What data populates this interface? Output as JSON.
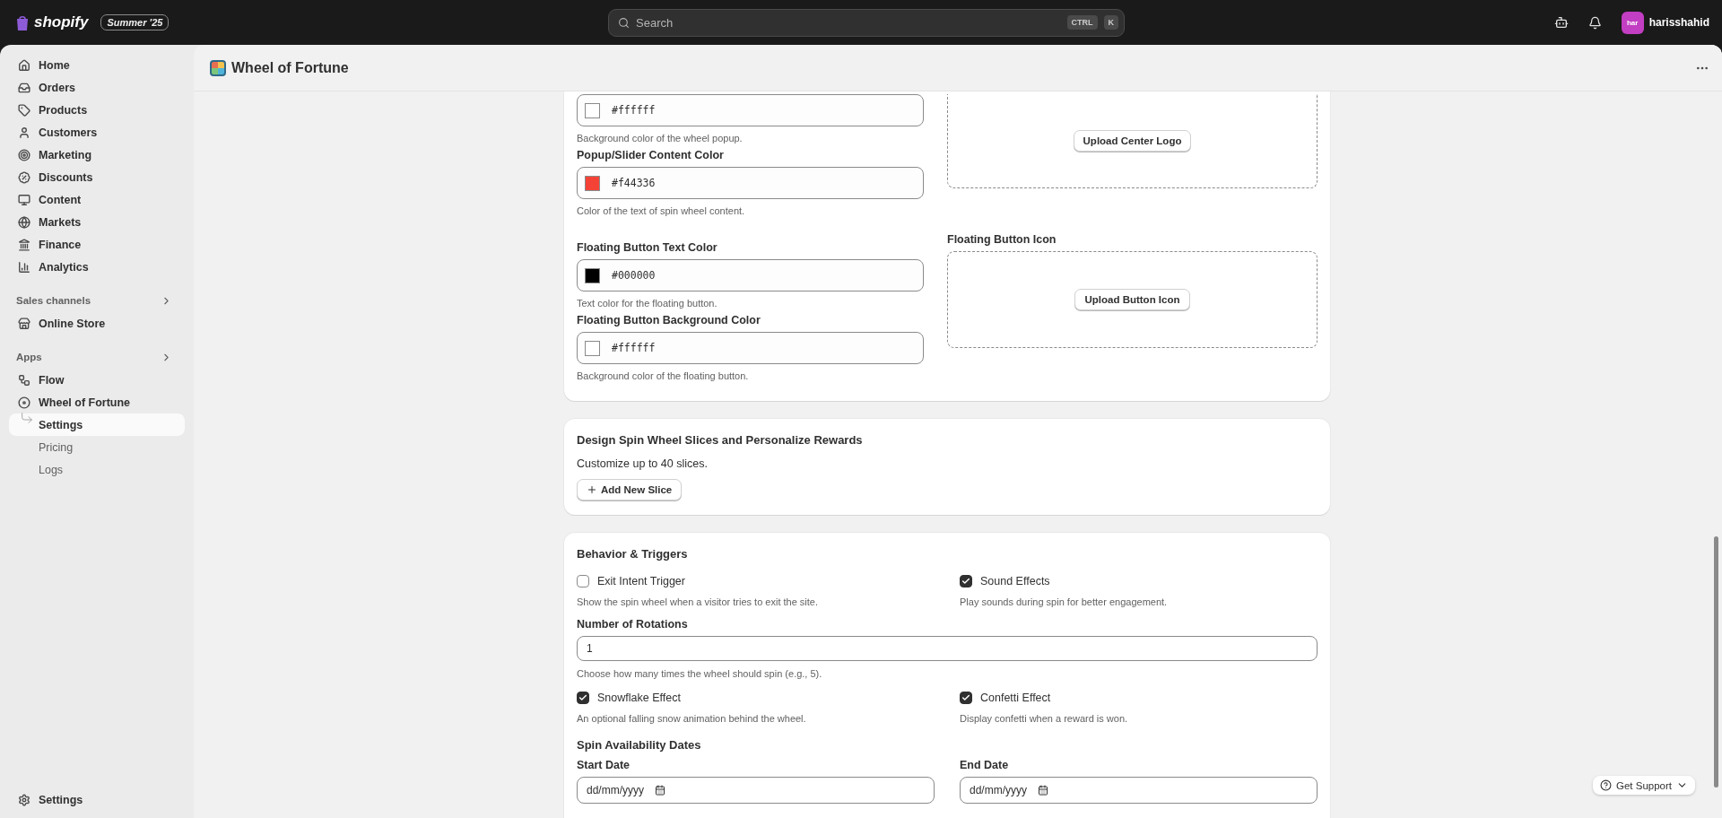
{
  "topbar": {
    "brand": "shopify",
    "edition": "Summer '25",
    "search": {
      "placeholder": "Search",
      "keys": [
        "CTRL",
        "K"
      ]
    },
    "avatar": "har",
    "user": "harisshahid"
  },
  "sidebar": {
    "items": [
      {
        "label": "Home"
      },
      {
        "label": "Orders"
      },
      {
        "label": "Products"
      },
      {
        "label": "Customers"
      },
      {
        "label": "Marketing"
      },
      {
        "label": "Discounts"
      },
      {
        "label": "Content"
      },
      {
        "label": "Markets"
      },
      {
        "label": "Finance"
      },
      {
        "label": "Analytics"
      }
    ],
    "sections": [
      {
        "title": "Sales channels",
        "items": [
          {
            "label": "Online Store"
          }
        ]
      },
      {
        "title": "Apps",
        "items": [
          {
            "label": "Flow"
          },
          {
            "label": "Wheel of Fortune",
            "children": [
              {
                "label": "Settings",
                "selected": true
              },
              {
                "label": "Pricing",
                "selected": false
              },
              {
                "label": "Logs",
                "selected": false
              }
            ]
          }
        ]
      }
    ],
    "footer": "Settings"
  },
  "page": {
    "title": "Wheel of Fortune"
  },
  "appearance": {
    "colors": [
      {
        "value": "#ffffff",
        "color": "#ffffff",
        "hint": "Background color of the wheel popup."
      },
      {
        "label": "Popup/Slider Content Color",
        "value": "#f44336",
        "color": "#f44336",
        "hint": "Color of the text of spin wheel content."
      },
      {
        "label": "Floating Button Text Color",
        "value": "#000000",
        "color": "#000000",
        "hint": "Text color for the floating button."
      },
      {
        "label": "Floating Button Background Color",
        "value": "#ffffff",
        "color": "#ffffff",
        "hint": "Background color of the floating button."
      }
    ],
    "uploads": [
      {
        "button": "Upload Center Logo"
      },
      {
        "label": "Floating Button Icon",
        "button": "Upload Button Icon"
      }
    ]
  },
  "slices": {
    "title": "Design Spin Wheel Slices and Personalize Rewards",
    "text": "Customize up to 40 slices.",
    "button": "Add New Slice"
  },
  "behavior": {
    "title": "Behavior & Triggers",
    "toggles_top": [
      {
        "label": "Exit Intent Trigger",
        "checked": false,
        "hint": "Show the spin wheel when a visitor tries to exit the site."
      },
      {
        "label": "Sound Effects",
        "checked": true,
        "hint": "Play sounds during spin for better engagement."
      }
    ],
    "rotations": {
      "label": "Number of Rotations",
      "value": "1",
      "hint": "Choose how many times the wheel should spin (e.g., 5)."
    },
    "toggles_bottom": [
      {
        "label": "Snowflake Effect",
        "checked": true,
        "hint": "An optional falling snow animation behind the wheel."
      },
      {
        "label": "Confetti Effect",
        "checked": true,
        "hint": "Display confetti when a reward is won."
      }
    ],
    "dates_title": "Spin Availability Dates",
    "dates": [
      {
        "label": "Start Date",
        "placeholder": "dd/mm/yyyy"
      },
      {
        "label": "End Date",
        "placeholder": "dd/mm/yyyy"
      }
    ]
  },
  "support": {
    "label": "Get Support"
  }
}
